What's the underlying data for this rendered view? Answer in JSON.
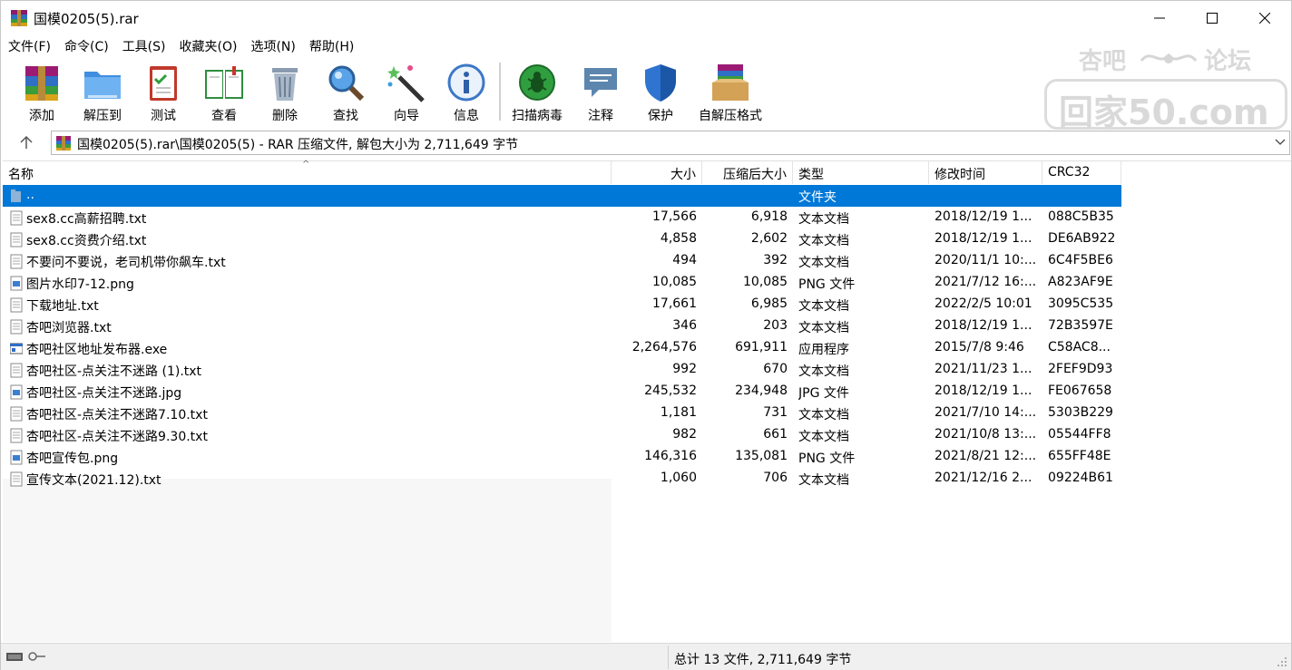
{
  "window": {
    "title": "国模0205(5).rar"
  },
  "menu": [
    "文件(F)",
    "命令(C)",
    "工具(S)",
    "收藏夹(O)",
    "选项(N)",
    "帮助(H)"
  ],
  "toolbar": {
    "add": "添加",
    "extract": "解压到",
    "test": "测试",
    "view": "查看",
    "delete": "删除",
    "find": "查找",
    "wizard": "向导",
    "info": "信息",
    "scan": "扫描病毒",
    "comment": "注释",
    "protect": "保护",
    "sfx": "自解压格式"
  },
  "watermark": {
    "line1_left": "杏吧",
    "line1_right": "论坛",
    "line2": "回家50.com"
  },
  "address": {
    "text": "国模0205(5).rar\\国模0205(5) - RAR 压缩文件, 解包大小为 2,711,649 字节"
  },
  "columns": {
    "name": "名称",
    "size": "大小",
    "packed": "压缩后大小",
    "type": "类型",
    "modified": "修改时间",
    "crc": "CRC32"
  },
  "parent_row": {
    "name": "..",
    "type": "文件夹"
  },
  "files": [
    {
      "name": "sex8.cc高薪招聘.txt",
      "size": "17,566",
      "packed": "6,918",
      "type": "文本文档",
      "modified": "2018/12/19 1...",
      "crc": "088C5B35",
      "icon": "text-file-icon"
    },
    {
      "name": "sex8.cc资费介绍.txt",
      "size": "4,858",
      "packed": "2,602",
      "type": "文本文档",
      "modified": "2018/12/19 1...",
      "crc": "DE6AB922",
      "icon": "text-file-icon"
    },
    {
      "name": "不要问不要说，老司机带你飙车.txt",
      "size": "494",
      "packed": "392",
      "type": "文本文档",
      "modified": "2020/11/1 10:...",
      "crc": "6C4F5BE6",
      "icon": "text-file-icon"
    },
    {
      "name": "图片水印7-12.png",
      "size": "10,085",
      "packed": "10,085",
      "type": "PNG 文件",
      "modified": "2021/7/12 16:...",
      "crc": "A823AF9E",
      "icon": "image-file-icon"
    },
    {
      "name": "下载地址.txt",
      "size": "17,661",
      "packed": "6,985",
      "type": "文本文档",
      "modified": "2022/2/5 10:01",
      "crc": "3095C535",
      "icon": "text-file-icon"
    },
    {
      "name": "杏吧浏览器.txt",
      "size": "346",
      "packed": "203",
      "type": "文本文档",
      "modified": "2018/12/19 1...",
      "crc": "72B3597E",
      "icon": "text-file-icon"
    },
    {
      "name": "杏吧社区地址发布器.exe",
      "size": "2,264,576",
      "packed": "691,911",
      "type": "应用程序",
      "modified": "2015/7/8 9:46",
      "crc": "C58AC8...",
      "icon": "exe-file-icon"
    },
    {
      "name": "杏吧社区-点关注不迷路 (1).txt",
      "size": "992",
      "packed": "670",
      "type": "文本文档",
      "modified": "2021/11/23 1...",
      "crc": "2FEF9D93",
      "icon": "text-file-icon"
    },
    {
      "name": "杏吧社区-点关注不迷路.jpg",
      "size": "245,532",
      "packed": "234,948",
      "type": "JPG 文件",
      "modified": "2018/12/19 1...",
      "crc": "FE067658",
      "icon": "image-file-icon"
    },
    {
      "name": "杏吧社区-点关注不迷路7.10.txt",
      "size": "1,181",
      "packed": "731",
      "type": "文本文档",
      "modified": "2021/7/10 14:...",
      "crc": "5303B229",
      "icon": "text-file-icon"
    },
    {
      "name": "杏吧社区-点关注不迷路9.30.txt",
      "size": "982",
      "packed": "661",
      "type": "文本文档",
      "modified": "2021/10/8 13:...",
      "crc": "05544FF8",
      "icon": "text-file-icon"
    },
    {
      "name": "杏吧宣传包.png",
      "size": "146,316",
      "packed": "135,081",
      "type": "PNG 文件",
      "modified": "2021/8/21 12:...",
      "crc": "655FF48E",
      "icon": "image-file-icon"
    },
    {
      "name": "宣传文本(2021.12).txt",
      "size": "1,060",
      "packed": "706",
      "type": "文本文档",
      "modified": "2021/12/16 2...",
      "crc": "09224B61",
      "icon": "text-file-icon"
    }
  ],
  "status": {
    "text": "总计 13 文件, 2,711,649 字节"
  },
  "colors": {
    "selection": "#0078d7",
    "accent": "#1f6fd1"
  }
}
